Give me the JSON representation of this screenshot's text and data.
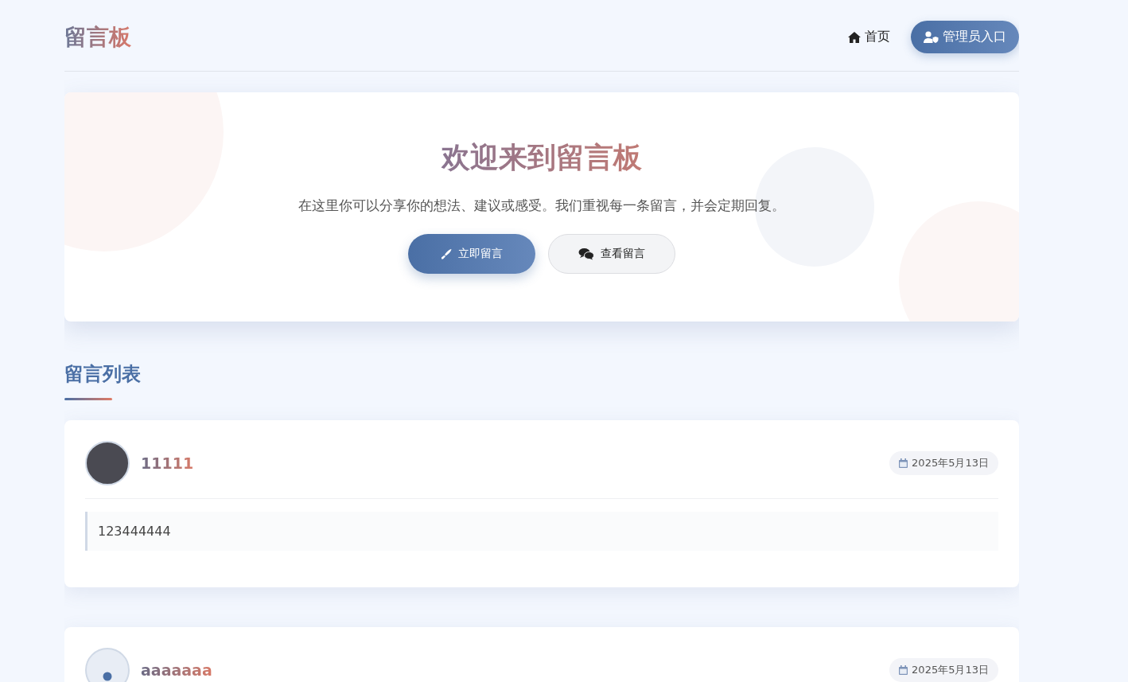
{
  "header": {
    "logo": "留言板",
    "nav": [
      {
        "kind": "link",
        "label": "首页"
      },
      {
        "kind": "button",
        "label": "管理员入口"
      }
    ]
  },
  "hero": {
    "title": "欢迎来到留言板",
    "subtitle": "在这里你可以分享你的想法、建议或感受。我们重视每一条留言，并会定期回复。",
    "buttons": [
      {
        "kind": "primary",
        "label": "立即留言"
      },
      {
        "kind": "secondary",
        "label": "查看留言"
      }
    ]
  },
  "section_title": "留言列表",
  "messages": [
    {
      "kind": "photo",
      "name": "11111",
      "date": "2025年5月13日",
      "content": "123444444"
    },
    {
      "kind": "default",
      "name": "aaaaaaa",
      "date": "2025年5月13日"
    }
  ]
}
